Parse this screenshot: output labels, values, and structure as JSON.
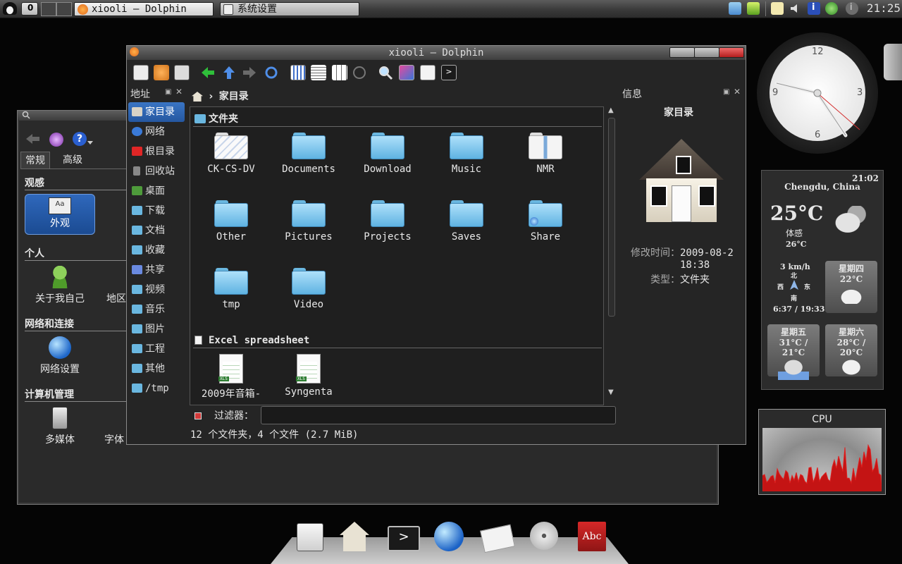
{
  "taskbar": {
    "desktop_number": "0",
    "tasks": [
      {
        "label": "xiooli — Dolphin"
      },
      {
        "label": "系统设置"
      }
    ],
    "clock": "21:25"
  },
  "settings_window": {
    "tabs": [
      "常规",
      "高级"
    ],
    "sections": [
      {
        "title": "观感",
        "items": [
          "外观"
        ]
      },
      {
        "title": "个人",
        "items": [
          "关于我自己",
          "地区"
        ]
      },
      {
        "title": "网络和连接",
        "items": [
          "网络设置"
        ]
      },
      {
        "title": "计算机管理",
        "items": [
          "多媒体",
          "字体"
        ]
      }
    ]
  },
  "dolphin": {
    "title": "xiooli — Dolphin",
    "places_header": "地址",
    "places": [
      "家目录",
      "网络",
      "根目录",
      "回收站",
      "桌面",
      "下载",
      "文档",
      "收藏",
      "共享",
      "视频",
      "音乐",
      "图片",
      "工程",
      "其他",
      "/tmp"
    ],
    "breadcrumb": "家目录",
    "groups": [
      {
        "title": "文件夹",
        "items": [
          "CK-CS-DV",
          "Documents",
          "Download",
          "Music",
          "NMR",
          "Other",
          "Pictures",
          "Projects",
          "Saves",
          "Share",
          "tmp",
          "Video"
        ]
      },
      {
        "title": "Excel spreadsheet",
        "items": [
          "2009年音箱-",
          "Syngenta"
        ]
      }
    ],
    "filter_label": "过滤器：",
    "filter_value": "",
    "status": "12 个文件夹，4 个文件 (2.7 MiB)",
    "info": {
      "header": "信息",
      "name": "家目录",
      "modified_label": "修改时间：",
      "modified_value": "2009-08-2",
      "modified_value_2": "18:38",
      "type_label": "类型：",
      "type_value": "文件夹"
    }
  },
  "clock_widget": {
    "labels": [
      "12",
      "3",
      "6",
      "9"
    ]
  },
  "weather": {
    "time": "21:02",
    "city": "Chengdu, China",
    "temp": "25°C",
    "feels_label": "体感",
    "feels_value": "26°C",
    "wind": "3 km/h",
    "compass": [
      "北",
      "西",
      "东",
      "南"
    ],
    "sun": "6:37 / 19:33",
    "forecast": [
      {
        "day": "星期四",
        "temp": "22°C"
      },
      {
        "day": "星期五",
        "temp": "31°C / 21°C"
      },
      {
        "day": "星期六",
        "temp": "28°C / 20°C"
      }
    ]
  },
  "cpu": {
    "title": "CPU"
  },
  "colors": {
    "selection": "#3a75c4",
    "folder": "#6ab7e0",
    "cpu_graph": "#d21515"
  }
}
